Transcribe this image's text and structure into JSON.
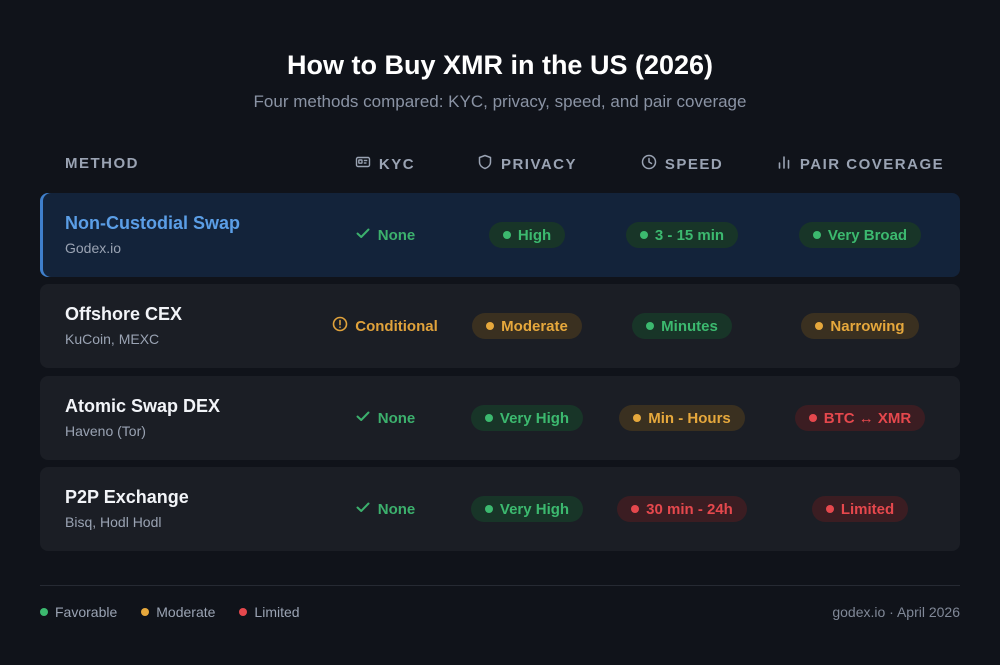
{
  "title": "How to Buy XMR in the US (2026)",
  "subtitle": "Four methods compared: KYC, privacy, speed, and pair coverage",
  "columns": {
    "method": "METHOD",
    "kyc": "KYC",
    "privacy": "PRIVACY",
    "speed": "SPEED",
    "pair": "PAIR COVERAGE"
  },
  "column_icons": {
    "kyc": "id-card-icon",
    "privacy": "shield-icon",
    "speed": "clock-icon",
    "pair": "bar-chart-icon"
  },
  "rows": [
    {
      "method": "Non-Custodial Swap",
      "sub": "Godex.io",
      "highlighted": true,
      "kyc": {
        "label": "None",
        "level": "favorable",
        "icon": "check-icon"
      },
      "privacy": {
        "label": "High",
        "level": "favorable"
      },
      "speed": {
        "label": "3 - 15 min",
        "level": "favorable"
      },
      "pair": {
        "label": "Very Broad",
        "level": "favorable"
      }
    },
    {
      "method": "Offshore CEX",
      "sub": "KuCoin, MEXC",
      "highlighted": false,
      "kyc": {
        "label": "Conditional",
        "level": "moderate",
        "icon": "alert-circle-icon"
      },
      "privacy": {
        "label": "Moderate",
        "level": "moderate"
      },
      "speed": {
        "label": "Minutes",
        "level": "favorable"
      },
      "pair": {
        "label": "Narrowing",
        "level": "moderate"
      }
    },
    {
      "method": "Atomic Swap DEX",
      "sub": "Haveno (Tor)",
      "highlighted": false,
      "kyc": {
        "label": "None",
        "level": "favorable",
        "icon": "check-icon"
      },
      "privacy": {
        "label": "Very High",
        "level": "favorable"
      },
      "speed": {
        "label": "Min - Hours",
        "level": "moderate"
      },
      "pair": {
        "label": "BTC ↔ XMR",
        "level": "limited"
      }
    },
    {
      "method": "P2P Exchange",
      "sub": "Bisq, Hodl Hodl",
      "highlighted": false,
      "kyc": {
        "label": "None",
        "level": "favorable",
        "icon": "check-icon"
      },
      "privacy": {
        "label": "Very High",
        "level": "favorable"
      },
      "speed": {
        "label": "30 min - 24h",
        "level": "limited"
      },
      "pair": {
        "label": "Limited",
        "level": "limited"
      }
    }
  ],
  "legend": [
    {
      "label": "Favorable",
      "color": "#3cb96f"
    },
    {
      "label": "Moderate",
      "color": "#e6a83c"
    },
    {
      "label": "Limited",
      "color": "#e5484d"
    }
  ],
  "credit": "godex.io · April 2026"
}
